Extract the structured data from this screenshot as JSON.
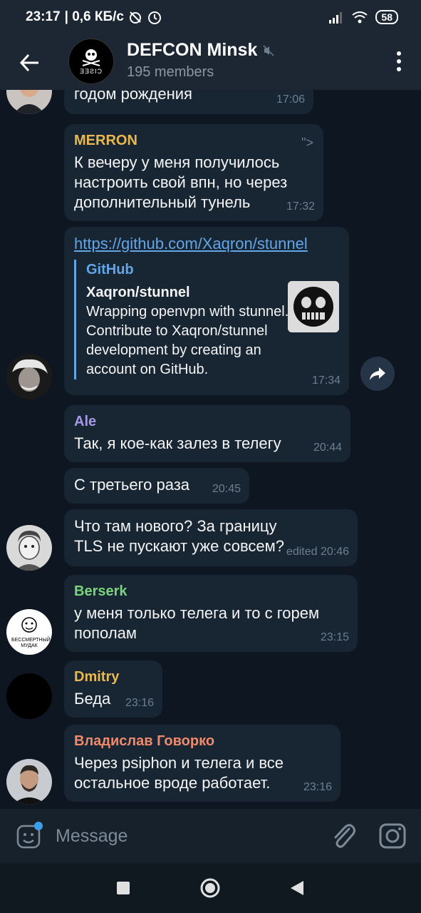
{
  "status_bar": {
    "time": "23:17",
    "speed": "| 0,6 КБ/с",
    "battery": "58"
  },
  "header": {
    "title": "DEFCON Minsk",
    "members": "195 members",
    "avatar_text": "ƎƎƧIƆ"
  },
  "messages": [
    {
      "text": "годом рождения",
      "time": "17:06"
    },
    {
      "sender": "MERRON",
      "sender_color": "#e9b94f",
      "quote_mark": "\">",
      "text": "К вечеру у меня получилось настроить свой впн, но через дополнительный тунель",
      "time": "17:32"
    },
    {
      "link": "https://github.com/Xaqron/stunnel",
      "preview": {
        "site": "GitHub",
        "title": "Xaqron/stunnel",
        "description": "Wrapping openvpn with stunnel. Contribute to Xaqron/stunnel development by creating an account on GitHub."
      },
      "time": "17:34"
    },
    {
      "sender": "Ale",
      "sender_color": "#a598e9",
      "text": "Так, я кое-как залез в телегу",
      "time": "20:44"
    },
    {
      "text": "С третьего раза",
      "time": "20:45"
    },
    {
      "text": "Что там нового? За границу TLS не пускают уже совсем?",
      "time": "edited 20:46"
    },
    {
      "sender": "Berserk",
      "sender_color": "#7ad47b",
      "text": "у меня только телега и то с горем пополам",
      "time": "23:15"
    },
    {
      "sender": "Dmitry",
      "sender_color": "#e9b94f",
      "text": "Беда",
      "time": "23:16"
    },
    {
      "sender": "Владислав Говорко",
      "sender_color": "#f08a6d",
      "text": "Через psiphon и телега и все остальное вроде работает.",
      "time": "23:16"
    }
  ],
  "avatars": {
    "berserk_caption": "БЕССМЕРТНЫЙ МУДАК"
  },
  "input": {
    "placeholder": "Message"
  },
  "icons": {
    "back": "arrow-left-icon",
    "mute": "muted-speaker-icon",
    "more": "more-vertical-icon",
    "share": "share-icon",
    "emoji": "sticker-emoji-icon",
    "attach": "paperclip-icon",
    "camera": "camera-icon",
    "nav_recent": "square-icon",
    "nav_home": "circle-icon",
    "nav_back": "triangle-back-icon"
  },
  "colors": {
    "accent": "#62a6e8",
    "bubble": "#182533",
    "background": "#0e1621",
    "header": "#1c2733"
  }
}
